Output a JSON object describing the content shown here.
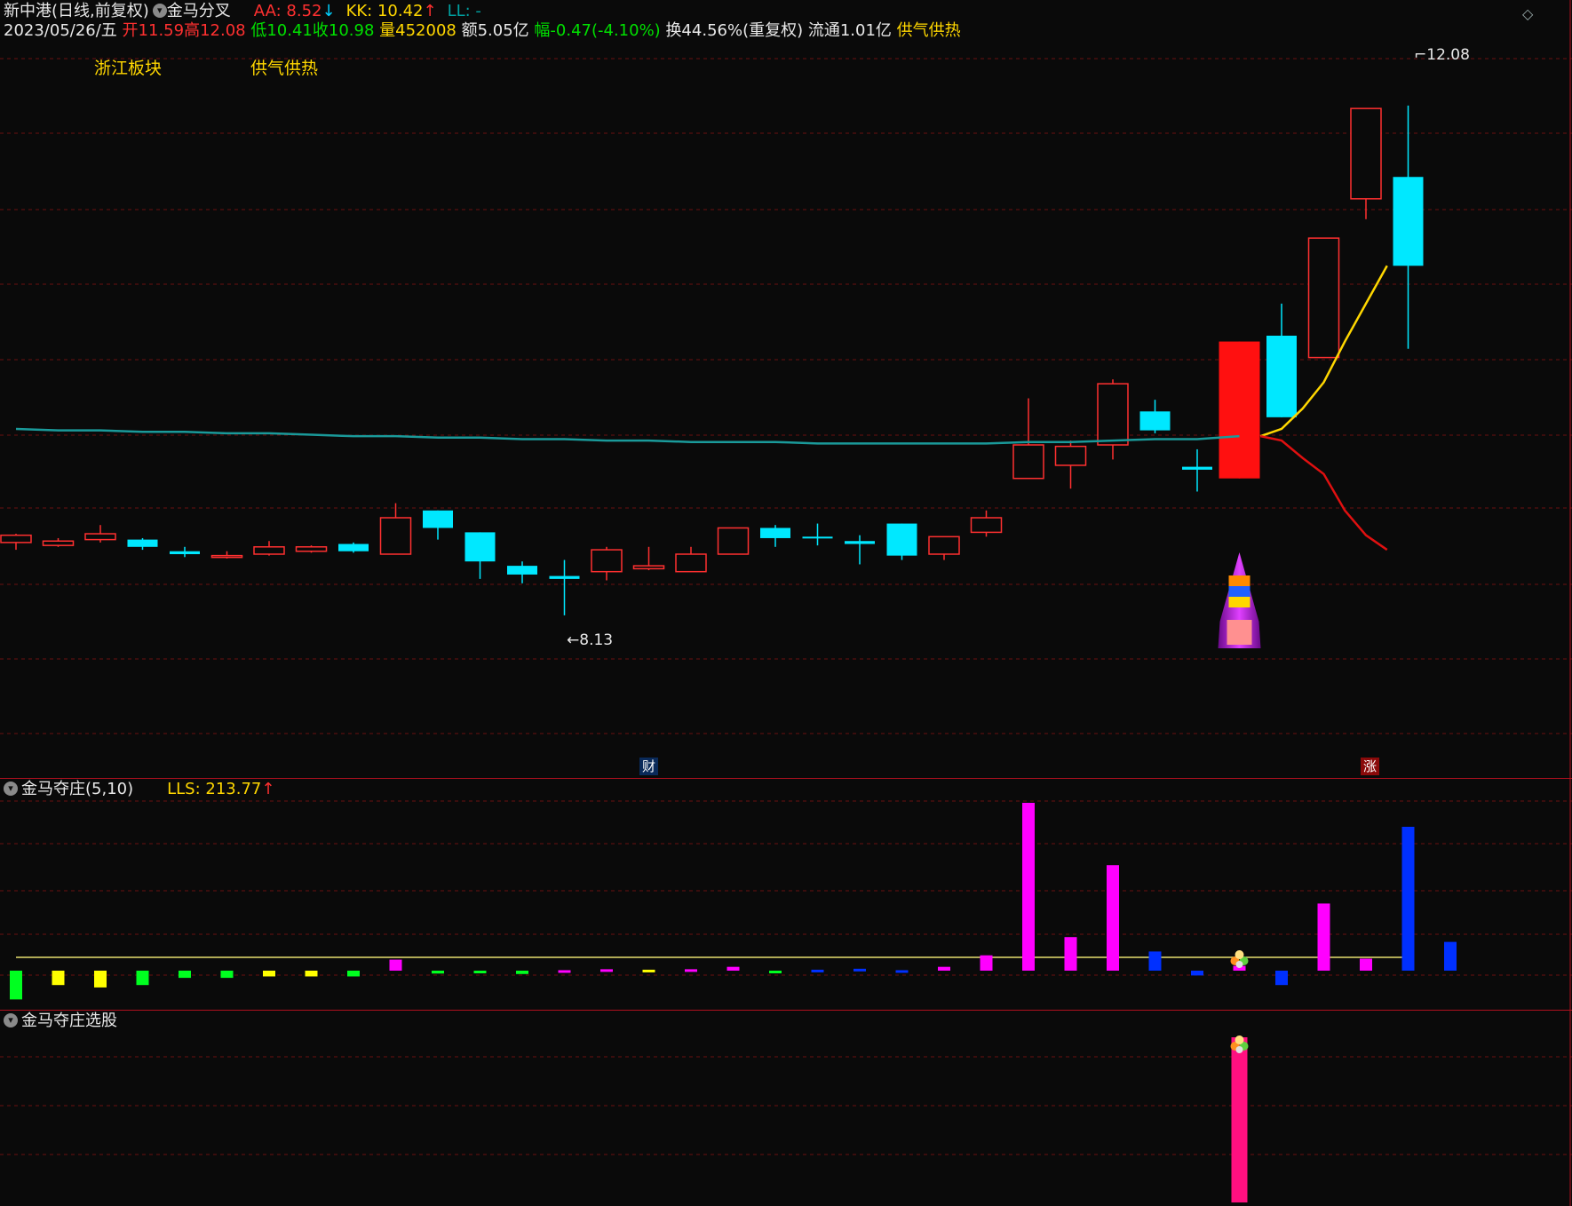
{
  "header": {
    "stock_name": "新中港",
    "period_mode": "(日线,前复权)",
    "indicator_name": "金马分叉",
    "aa_label": "AA: ",
    "aa_value": "8.52",
    "aa_arrow": "↓",
    "kk_label": "KK: ",
    "kk_value": "10.42",
    "kk_arrow": "↑",
    "ll_label": "LL: -",
    "date": "2023/05/26/五",
    "open": "开11.59",
    "high": "高12.08",
    "low": "低10.41",
    "close": "收10.98",
    "volume": "量452008",
    "amount": "额5.05亿",
    "change": "幅-0.47(-4.10%)",
    "turnover": "换44.56%(重复权)",
    "float_cap": "流通1.01亿",
    "concept": "供气供热",
    "colors": {
      "red": "#ff3030",
      "green": "#00e000",
      "yellow": "#ffd700",
      "white": "#e8e8e8",
      "cyan": "#00c0c0"
    }
  },
  "labels": {
    "sector": "浙江板块",
    "concept": "供气供热",
    "price_high": "12.08",
    "price_low": "8.13"
  },
  "markers": {
    "cai": "财",
    "zhang": "涨"
  },
  "panel2": {
    "title": "金马夺庄(5,10)",
    "lls_label": "LLS: ",
    "lls_value": "213.77",
    "lls_arrow": "↑"
  },
  "panel3": {
    "title": "金马夺庄选股"
  },
  "icons": {
    "dropdown": "chevron-down-icon",
    "corner": "diamond-icon",
    "rocket": "rocket-icon",
    "flower": "flower-icon"
  },
  "chart_data": {
    "type": "candlestick",
    "price_range": [
      7.5,
      12.5
    ],
    "candles": [
      {
        "o": 9.08,
        "c": 9.13,
        "h": 9.14,
        "l": 9.03
      },
      {
        "o": 9.06,
        "c": 9.09,
        "h": 9.11,
        "l": 9.05
      },
      {
        "o": 9.1,
        "c": 9.14,
        "h": 9.2,
        "l": 9.08
      },
      {
        "o": 9.1,
        "c": 9.05,
        "h": 9.11,
        "l": 9.03
      },
      {
        "o": 9.02,
        "c": 9.0,
        "h": 9.05,
        "l": 8.98
      },
      {
        "o": 8.99,
        "c": 8.99,
        "h": 9.02,
        "l": 8.97
      },
      {
        "o": 9.0,
        "c": 9.05,
        "h": 9.09,
        "l": 8.99
      },
      {
        "o": 9.02,
        "c": 9.05,
        "h": 9.06,
        "l": 9.01
      },
      {
        "o": 9.07,
        "c": 9.02,
        "h": 9.08,
        "l": 9.01
      },
      {
        "o": 9.0,
        "c": 9.25,
        "h": 9.35,
        "l": 9.0
      },
      {
        "o": 9.3,
        "c": 9.18,
        "h": 9.3,
        "l": 9.1
      },
      {
        "o": 9.15,
        "c": 8.95,
        "h": 9.15,
        "l": 8.83
      },
      {
        "o": 8.92,
        "c": 8.86,
        "h": 8.95,
        "l": 8.8
      },
      {
        "o": 8.85,
        "c": 8.83,
        "h": 8.96,
        "l": 8.58
      },
      {
        "o": 8.88,
        "c": 9.03,
        "h": 9.05,
        "l": 8.82
      },
      {
        "o": 8.9,
        "c": 8.92,
        "h": 9.05,
        "l": 8.89
      },
      {
        "o": 8.88,
        "c": 9.0,
        "h": 9.05,
        "l": 8.88
      },
      {
        "o": 9.0,
        "c": 9.18,
        "h": 9.18,
        "l": 9.0
      },
      {
        "o": 9.18,
        "c": 9.11,
        "h": 9.2,
        "l": 9.05
      },
      {
        "o": 9.12,
        "c": 9.11,
        "h": 9.21,
        "l": 9.06
      },
      {
        "o": 9.09,
        "c": 9.07,
        "h": 9.13,
        "l": 8.93
      },
      {
        "o": 9.21,
        "c": 8.99,
        "h": 9.21,
        "l": 8.96
      },
      {
        "o": 9.0,
        "c": 9.12,
        "h": 9.12,
        "l": 8.96
      },
      {
        "o": 9.15,
        "c": 9.25,
        "h": 9.3,
        "l": 9.12
      },
      {
        "o": 9.52,
        "c": 9.75,
        "h": 10.07,
        "l": 9.52
      },
      {
        "o": 9.61,
        "c": 9.74,
        "h": 9.78,
        "l": 9.45
      },
      {
        "o": 9.75,
        "c": 10.17,
        "h": 10.2,
        "l": 9.65
      },
      {
        "o": 9.98,
        "c": 9.85,
        "h": 10.06,
        "l": 9.83
      },
      {
        "o": 9.6,
        "c": 9.58,
        "h": 9.72,
        "l": 9.43
      },
      {
        "o": 9.52,
        "c": 10.46,
        "h": 10.46,
        "l": 9.52
      },
      {
        "o": 10.5,
        "c": 9.94,
        "h": 10.72,
        "l": 9.94
      },
      {
        "o": 10.35,
        "c": 11.17,
        "h": 11.17,
        "l": 10.35
      },
      {
        "o": 11.44,
        "c": 12.06,
        "h": 12.06,
        "l": 11.3
      },
      {
        "o": 11.59,
        "c": 10.98,
        "h": 12.08,
        "l": 10.41
      }
    ],
    "ma_long": [
      9.86,
      9.85,
      9.85,
      9.84,
      9.84,
      9.83,
      9.83,
      9.82,
      9.81,
      9.81,
      9.8,
      9.8,
      9.79,
      9.79,
      9.78,
      9.78,
      9.77,
      9.77,
      9.77,
      9.76,
      9.76,
      9.76,
      9.76,
      9.76,
      9.77,
      9.77,
      9.78,
      9.79,
      9.79,
      9.81
    ],
    "ma_long_start": 0,
    "ma_yellow": [
      9.81,
      9.86,
      10.0,
      10.18,
      10.46,
      10.72,
      10.98
    ],
    "ma_red": [
      9.81,
      9.78,
      9.66,
      9.55,
      9.3,
      9.13,
      9.03
    ],
    "ma_branch_start": 29,
    "panel2_values": [
      -60,
      -30,
      -35,
      -30,
      -15,
      -15,
      -12,
      -12,
      -12,
      23,
      -6,
      -1,
      -7,
      1,
      3,
      2,
      3,
      8,
      -3,
      2,
      4,
      1,
      8,
      32,
      350,
      70,
      220,
      40,
      -10,
      10,
      -30,
      140,
      25,
      300,
      60
    ],
    "panel2_colors": [
      "#00ff20",
      "#ffff00",
      "#ffff00",
      "#00ff20",
      "#00ff20",
      "#00ff20",
      "#ffff00",
      "#ffff00",
      "#00ff20",
      "#ff00ff",
      "#00ff20",
      "#00ff20",
      "#00ff20",
      "#ff00ff",
      "#ff00ff",
      "#ffff00",
      "#ff00ff",
      "#ff00ff",
      "#00ff20",
      "#0030ff",
      "#0030ff",
      "#0030ff",
      "#ff00ff",
      "#ff00ff",
      "#ff00ff",
      "#ff00ff",
      "#ff00ff",
      "#0030ff",
      "#0030ff",
      "#ff00ff",
      "#0030ff",
      "#ff00ff",
      "#ff00ff",
      "#0030ff",
      "#0030ff"
    ],
    "panel3_signal_index": 29
  }
}
